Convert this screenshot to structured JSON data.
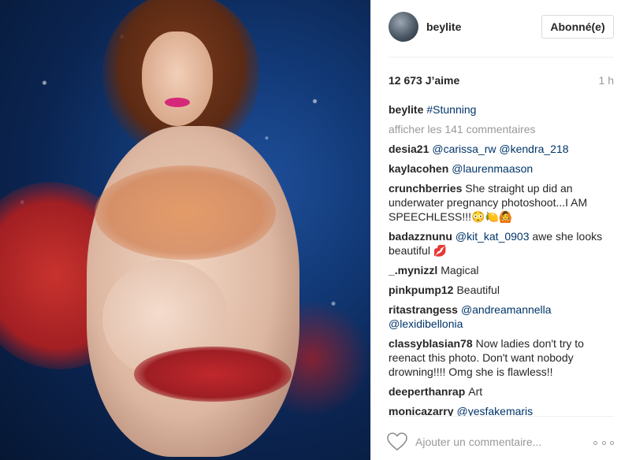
{
  "post": {
    "username": "beylite",
    "follow_button": "Abonné(e)",
    "likes": "12 673 J’aime",
    "time": "1 h"
  },
  "caption": {
    "author": "beylite",
    "text": "#Stunning"
  },
  "show_comments": "afficher les 141 commentaires",
  "comments": [
    {
      "author": "desia21",
      "mention": "@carissa_rw @kendra_218",
      "text": ""
    },
    {
      "author": "kaylacohen",
      "mention": "@laurenmaason",
      "text": ""
    },
    {
      "author": "crunchberries",
      "mention": "",
      "text": "She straight up did an underwater pregnancy photoshoot...I AM SPEECHLESS!!!😳🍋🙆"
    },
    {
      "author": "badazznunu",
      "mention": "@kit_kat_0903",
      "text": "awe she looks beautiful 💋"
    },
    {
      "author": "_.mynizzl",
      "mention": "",
      "text": "Magical"
    },
    {
      "author": "pinkpump12",
      "mention": "",
      "text": "Beautiful"
    },
    {
      "author": "ritastrangess",
      "mention": "@andreamannella @lexidibellonia",
      "text": ""
    },
    {
      "author": "classyblasian78",
      "mention": "",
      "text": "Now ladies don't try to reenact this photo. Don't want nobody drowning!!!! Omg she is flawless!!"
    },
    {
      "author": "deeperthanrap",
      "mention": "",
      "text": "Art"
    },
    {
      "author": "monicazarry",
      "mention": "@yesfakemaris",
      "text": ""
    }
  ],
  "footer": {
    "add_comment_placeholder": "Ajouter un commentaire..."
  },
  "icons": {
    "like": "heart-icon",
    "options": "more-options-icon"
  }
}
